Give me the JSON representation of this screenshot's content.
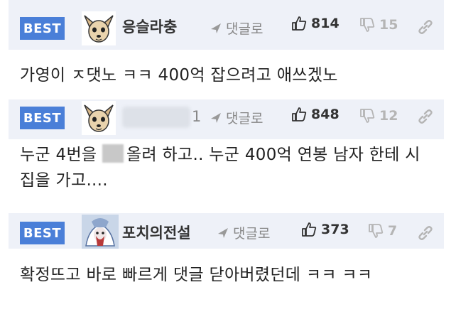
{
  "comments": [
    {
      "badge": "BEST",
      "username": "응슬라충",
      "reply_label": "댓글로",
      "likes": "814",
      "dislikes": "15",
      "text": "가영이 ㅈ댓노 ㅋㅋ 400억 잡으려고 애쓰겠노",
      "avatar_icon": "chihuahua-avatar-icon"
    },
    {
      "badge": "BEST",
      "username_prefix_number": "1",
      "reply_label": "댓글로",
      "likes": "848",
      "dislikes": "12",
      "text_part1": "누군 4번을",
      "text_part2": "올려 하고.. 누군 400억 연봉 남자 한테 시집을 가고....",
      "avatar_icon": "chihuahua-avatar-icon"
    },
    {
      "badge": "BEST",
      "username": "포치의전설",
      "reply_label": "댓글로",
      "likes": "373",
      "dislikes": "7",
      "text": "확정뜨고 바로 빠르게 댓글 닫아버렸던데 ㅋㅋ ㅋㅋ",
      "avatar_icon": "character-avatar-icon"
    }
  ],
  "colors": {
    "header_bg": "#eef1f8",
    "badge_bg": "#4a7fd8",
    "muted": "#888888"
  }
}
